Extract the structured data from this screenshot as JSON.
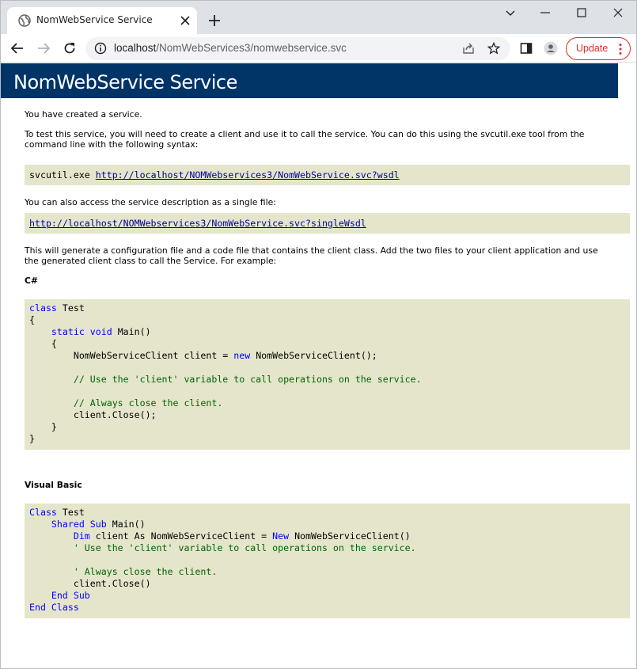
{
  "browser": {
    "tab_title": "NomWebService Service",
    "url_host": "localhost",
    "url_path": "/NomWebServices3/nomwebservice.svc",
    "update_label": "Update",
    "accent_color": "#d93025"
  },
  "page": {
    "banner_title": "NomWebService Service",
    "banner_color": "#003366",
    "intro": "You have created a service.",
    "test_text_line1": "To test this service, you will need to create a client and use it to call the service. You can do this using the svcutil.exe tool from the",
    "test_text_line2": "command line with the following syntax:",
    "svcutil_cmd": "svcutil.exe",
    "wsdl_url": "http://localhost/NOMWebservices3/NomWebService.svc?wsdl",
    "single_file_text": "You can also access the service description as a single file:",
    "single_wsdl_url": "http://localhost/NOMWebservices3/NomWebService.svc?singleWsdl",
    "generate_line1": "This will generate a configuration file and a code file that contains the client class. Add the two files to your client application and use",
    "generate_line2": "the generated client class to call the Service. For example:",
    "csharp_heading": "C#",
    "vb_heading": "Visual Basic",
    "code_bg": "#e5e5cc"
  },
  "csharp_code": {
    "l1_kw": "class",
    "l1_rest": " Test",
    "l2": "{",
    "l3_indent": "    ",
    "l3_kw1": "static",
    "l3_sp": " ",
    "l3_kw2": "void",
    "l3_rest": " Main()",
    "l4": "    {",
    "l5_a": "        NomWebServiceClient client = ",
    "l5_kw": "new",
    "l5_b": " NomWebServiceClient();",
    "l7": "        // Use the 'client' variable to call operations on the service.",
    "l9": "        // Always close the client.",
    "l10": "        client.Close();",
    "l11": "    }",
    "l12": "}"
  },
  "vb_code": {
    "l1_kw": "Class",
    "l1_rest": " Test",
    "l2_indent": "    ",
    "l2_kw": "Shared Sub",
    "l2_rest": " Main()",
    "l3_indent": "        ",
    "l3_kw1": "Dim",
    "l3_mid": " client As NomWebServiceClient = ",
    "l3_kw2": "New",
    "l3_rest": " NomWebServiceClient()",
    "l4": "        ' Use the 'client' variable to call operations on the service.",
    "l6": "        ' Always close the client.",
    "l7": "        client.Close()",
    "l8_indent": "    ",
    "l8_kw": "End Sub",
    "l9_kw": "End Class"
  }
}
